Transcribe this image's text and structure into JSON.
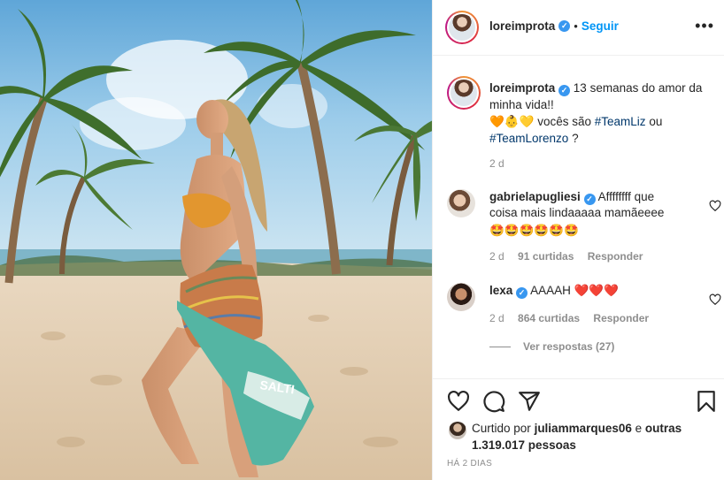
{
  "header": {
    "username": "loreimprota",
    "separator": "•",
    "follow_label": "Seguir",
    "more_label": "•••"
  },
  "caption": {
    "username": "loreimprota",
    "line1": "13 semanas do amor da minha vida!!",
    "mid_text": "vocês são",
    "hashtag1": "#TeamLiz",
    "or_text": "ou",
    "hashtag2": "#TeamLorenzo",
    "end_text": "?",
    "emoji": "🧡👶💛",
    "age": "2 d"
  },
  "comments": [
    {
      "username": "gabrielapugliesi",
      "text": "Affffffff que coisa mais lindaaaaa mamãeeee",
      "emoji": "🤩🤩🤩🤩🤩🤩",
      "age": "2 d",
      "likes": "91 curtidas",
      "reply_label": "Responder"
    },
    {
      "username": "lexa",
      "text": "AAAAH",
      "emoji": "❤️❤️❤️",
      "age": "2 d",
      "likes": "864 curtidas",
      "reply_label": "Responder"
    }
  ],
  "view_replies": "Ver respostas (27)",
  "likes": {
    "prefix": "Curtido por",
    "user": "juliammarques06",
    "connector": "e",
    "others": "outras 1.319.017 pessoas"
  },
  "timestamp": "HÁ 2 DIAS",
  "photo": {
    "towel_text": "SALTI"
  },
  "colors": {
    "link_blue": "#0095f6",
    "verified_blue": "#3897f0",
    "hashtag": "#00376b",
    "muted": "#8e8e8e",
    "text": "#262626"
  },
  "icons": [
    "heart-icon",
    "comment-icon",
    "share-icon",
    "bookmark-icon",
    "more-options-icon",
    "verified-icon"
  ]
}
